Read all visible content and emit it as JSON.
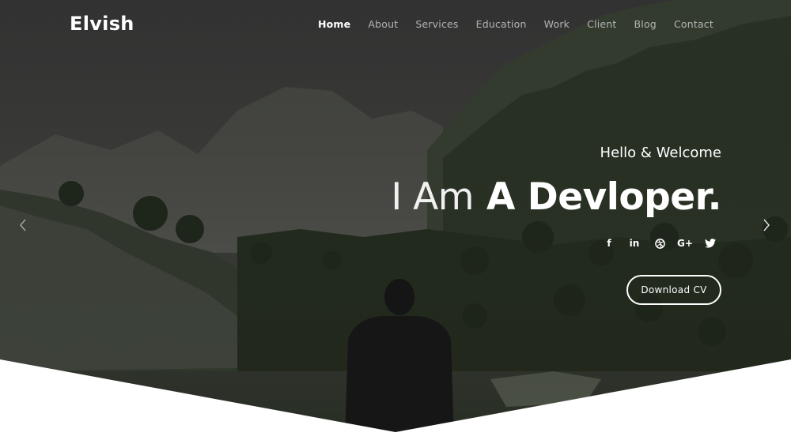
{
  "brand": {
    "name": "Elvish"
  },
  "nav": {
    "items": [
      "Home",
      "About",
      "Services",
      "Education",
      "Work",
      "Client",
      "Blog",
      "Contact"
    ],
    "active": "Home"
  },
  "hero": {
    "greeting": "Hello & Welcome",
    "headline_light": "I Am",
    "headline_bold": "A Devloper.",
    "cta": "Download CV",
    "social": [
      {
        "glyph": "f",
        "icon": "facebook-icon"
      },
      {
        "glyph": "in",
        "icon": "linkedin-icon"
      },
      {
        "glyph": "",
        "icon": "dribbble-icon"
      },
      {
        "glyph": "G+",
        "icon": "google-plus-icon"
      },
      {
        "glyph": "",
        "icon": "twitter-icon"
      }
    ]
  },
  "colors": {
    "overlay": "#2b2b2b",
    "text": "#ffffff",
    "foliage": "#2f3b28",
    "page_background": "#ffffff"
  }
}
